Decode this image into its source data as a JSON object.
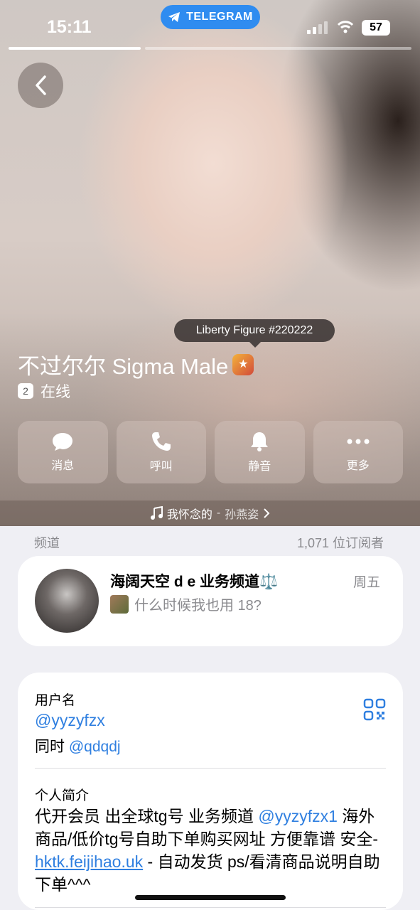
{
  "status_bar": {
    "time": "15:11",
    "app_pill": "TELEGRAM",
    "battery": "57"
  },
  "profile": {
    "tooltip": "Liberty Figure #220222",
    "name": "不过尔尔 Sigma Male",
    "online_badge": "2",
    "status": "在线"
  },
  "actions": [
    {
      "label": "消息",
      "icon": "message-icon"
    },
    {
      "label": "呼叫",
      "icon": "phone-icon"
    },
    {
      "label": "静音",
      "icon": "bell-icon"
    },
    {
      "label": "更多",
      "icon": "more-icon"
    }
  ],
  "music": {
    "title": "我怀念的",
    "separator": " - ",
    "artist": "孙燕姿"
  },
  "channel_section": {
    "label": "频道",
    "subscribers": "1,071 位订阅者"
  },
  "channel": {
    "title": "海阔天空 d e 业务频道⚖️",
    "day": "周五",
    "last_message": "什么时候我也用 18?"
  },
  "info": {
    "username_label": "用户名",
    "username": "@yyzyfzx",
    "also_prefix": "同时",
    "also_username": "@qdqdj",
    "bio_label": "个人简介",
    "bio_part1": "代开会员 出全球tg号 业务频道 ",
    "bio_link1": "@yyzyfzx1",
    "bio_part2": " 海外商品/低价tg号自助下单购买网址 方便靠谱 安全- ",
    "bio_link2": "hktk.feijihao.uk",
    "bio_part3": " - 自动发货 ps/看清商品说明自助下单^^^"
  },
  "colors": {
    "accent": "#2f7fe0",
    "telegram_pill": "#2f8cf0"
  }
}
